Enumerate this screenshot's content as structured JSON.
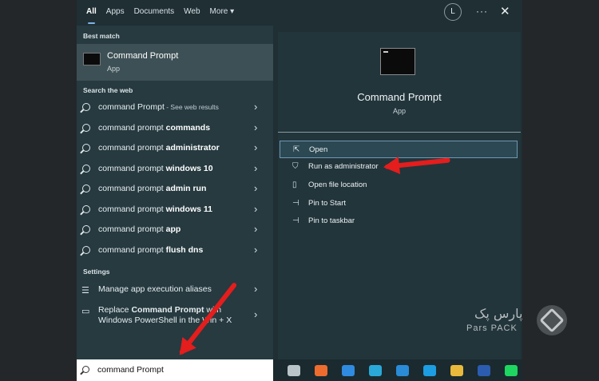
{
  "tabs": [
    {
      "label": "All"
    },
    {
      "label": "Apps"
    },
    {
      "label": "Documents"
    },
    {
      "label": "Web"
    },
    {
      "label": "More ▾"
    }
  ],
  "header": {
    "avatar": "L",
    "more": "···",
    "close": "✕"
  },
  "left": {
    "best_match_label": "Best match",
    "best_match": {
      "title": "Command Prompt",
      "subtitle": "App"
    },
    "web_label": "Search the web",
    "web_rows": [
      {
        "plain": "command Prompt",
        "bold": "",
        "extra": " - See web results"
      },
      {
        "plain": "command prompt ",
        "bold": "commands",
        "extra": ""
      },
      {
        "plain": "command prompt ",
        "bold": "administrator",
        "extra": ""
      },
      {
        "plain": "command prompt ",
        "bold": "windows 10",
        "extra": ""
      },
      {
        "plain": "command prompt ",
        "bold": "admin run",
        "extra": ""
      },
      {
        "plain": "command prompt ",
        "bold": "windows 11",
        "extra": ""
      },
      {
        "plain": "command prompt ",
        "bold": "app",
        "extra": ""
      },
      {
        "plain": "command prompt ",
        "bold": "flush dns",
        "extra": ""
      }
    ],
    "settings_label": "Settings",
    "settings": [
      {
        "line1": "Manage app execution aliases",
        "line2": ""
      },
      {
        "line1a": "Replace ",
        "line1b": "Command Prompt",
        "line1c": " with",
        "line2": "Windows PowerShell in the Win + X"
      }
    ]
  },
  "right": {
    "title": "Command Prompt",
    "subtitle": "App",
    "actions": [
      {
        "label": "Open",
        "icon": "open-icon"
      },
      {
        "label": "Run as administrator",
        "icon": "shield-icon"
      },
      {
        "label": "Open file location",
        "icon": "file-icon"
      },
      {
        "label": "Pin to Start",
        "icon": "pin-icon"
      },
      {
        "label": "Pin to taskbar",
        "icon": "pin-icon"
      }
    ]
  },
  "search": {
    "value": "command Prompt"
  },
  "taskbar": [
    {
      "name": "task-view-icon",
      "color": "#b9c4c8"
    },
    {
      "name": "store-icon",
      "color": "#ef6c2f"
    },
    {
      "name": "mail-icon",
      "color": "#2f8ae0"
    },
    {
      "name": "edge-icon",
      "color": "#2aa9d8"
    },
    {
      "name": "vscode-icon",
      "color": "#2a8bd6"
    },
    {
      "name": "skype-icon",
      "color": "#1d9de2"
    },
    {
      "name": "explorer-icon",
      "color": "#e9b93b"
    },
    {
      "name": "word-icon",
      "color": "#2b5cb0"
    },
    {
      "name": "spotify-icon",
      "color": "#1ed760"
    }
  ],
  "watermark": {
    "fa": "پارس پک",
    "en": "Pars PACK"
  },
  "colors": {
    "accent": "#6f97b3",
    "arrow": "#e41d1d",
    "panel": "#22353b"
  }
}
